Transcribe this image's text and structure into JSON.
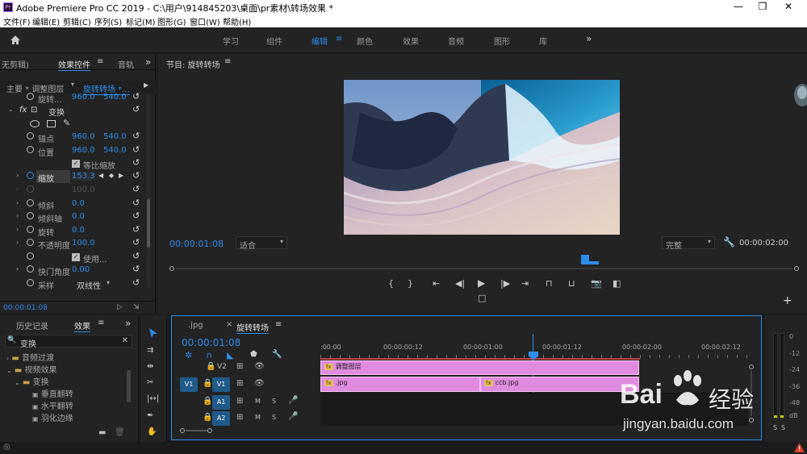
{
  "titlebar": {
    "app_logo": "Pr",
    "title": "Adobe Premiere Pro CC 2019 - C:\\用户\\914845203\\桌面\\pr素材\\转场效果 *",
    "minimize": "—",
    "restore": "❐",
    "close": "✕"
  },
  "menu": [
    "文件(F)",
    "编辑(E)",
    "剪辑(C)",
    "序列(S)",
    "标记(M)",
    "图形(G)",
    "窗口(W)",
    "帮助(H)"
  ],
  "workspaces": [
    "学习",
    "组件",
    "编辑",
    "颜色",
    "效果",
    "音频",
    "图形",
    "库"
  ],
  "workspace_active": "编辑",
  "effect_controls": {
    "tabs": [
      "无剪辑)",
      "效果控件",
      "音轨"
    ],
    "source": "主要 * 调整图层",
    "clip": "旋转转场 *...",
    "rows": [
      {
        "label": "旋转...",
        "v1": "960.0",
        "v2": "540.0"
      },
      {
        "label": "变换"
      },
      {
        "label": "锚点",
        "v1": "960.0",
        "v2": "540.0"
      },
      {
        "label": "位置",
        "v1": "960.0",
        "v2": "540.0"
      },
      {
        "label": "等比缩放"
      },
      {
        "label": "缩放",
        "v1": "153.3"
      },
      {
        "label": "",
        "v1": "100.0"
      },
      {
        "label": "倾斜",
        "v1": "0.0"
      },
      {
        "label": "倾斜轴",
        "v1": "0.0"
      },
      {
        "label": "旋转",
        "v1": "0.0"
      },
      {
        "label": "不透明度",
        "v1": "100.0"
      },
      {
        "label": "使用..."
      },
      {
        "label": "快门角度",
        "v1": "0.00"
      },
      {
        "label": "采样",
        "v1": "双线性"
      }
    ],
    "timecode": "00:00:01:08"
  },
  "program": {
    "title": "节目: 旋转转场",
    "timecode": "00:00:01:08",
    "fit": "适合",
    "quality": "完整",
    "duration": "00:00:02:00"
  },
  "effects_panel": {
    "tabs": [
      "历史记录",
      "效果"
    ],
    "search_value": "变换",
    "tree": [
      "音频过渡",
      "视频效果",
      "变换",
      "垂直翻转",
      "水平翻转",
      "羽化边缘"
    ]
  },
  "timeline": {
    "tabs": [
      ".jpg",
      "旋转转场"
    ],
    "timecode": "00:00:01:08",
    "ruler": [
      ":00:00",
      "00:00:00:12",
      "00:00:01:00",
      "00:00:01:12",
      "00:00:02:00",
      "00:00:02:12"
    ],
    "tracks": [
      {
        "id": "V2",
        "src": ""
      },
      {
        "id": "V1",
        "src": "V1"
      },
      {
        "id": "A1",
        "src": "A1"
      },
      {
        "id": "A2",
        "src": "A2"
      }
    ],
    "clips": [
      {
        "name": "调整图层"
      },
      {
        "name": ".jpg"
      },
      {
        "name": "ccb.jpg"
      }
    ]
  },
  "meter_labels": [
    "0",
    "-12",
    "-24",
    "-36",
    "-48",
    "dB"
  ],
  "watermark": {
    "brand": "Bai",
    "brand2": "经验",
    "url": "jingyan.baidu.com"
  }
}
